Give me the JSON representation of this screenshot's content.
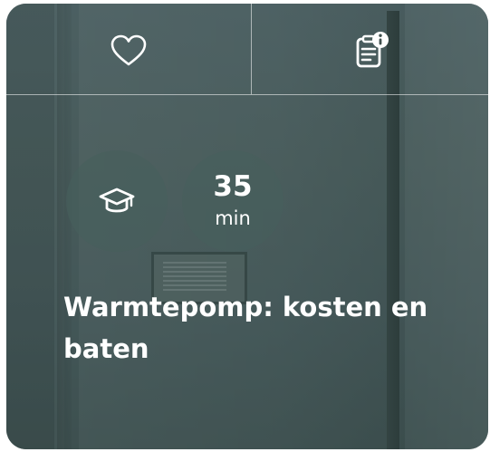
{
  "card": {
    "favorite_icon": "heart-outline-icon",
    "info_icon": "document-info-icon",
    "level_icon": "graduation-cap-icon",
    "duration": {
      "value": "35",
      "unit": "min"
    },
    "title": "Warmtepomp: kosten en baten"
  },
  "colors": {
    "overlay": "#3c5552",
    "text": "#ffffff"
  }
}
